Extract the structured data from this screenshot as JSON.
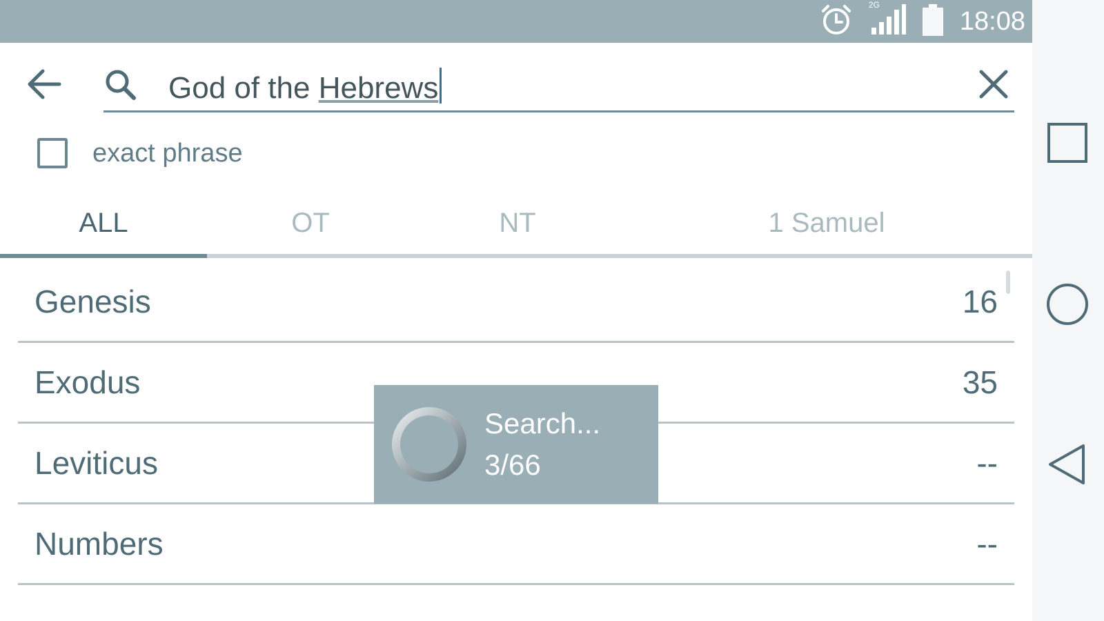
{
  "status_bar": {
    "time": "18:08",
    "network": "2G",
    "icons": [
      "alarm-icon",
      "signal-icon",
      "battery-icon"
    ]
  },
  "search": {
    "query_plain": "God of the ",
    "query_underlined": "Hebrews"
  },
  "exact_phrase": {
    "label": "exact phrase",
    "checked": false
  },
  "tabs": [
    {
      "label": "ALL",
      "active": true
    },
    {
      "label": "OT",
      "active": false
    },
    {
      "label": "NT",
      "active": false
    },
    {
      "label": "1 Samuel",
      "active": false
    }
  ],
  "results": [
    {
      "book": "Genesis",
      "count": "16"
    },
    {
      "book": "Exodus",
      "count": "35"
    },
    {
      "book": "Leviticus",
      "count": "--"
    },
    {
      "book": "Numbers",
      "count": "--"
    }
  ],
  "progress": {
    "title": "Search...",
    "count": "3/66"
  },
  "colors": {
    "accent": "#9aaeb5",
    "text": "#4f6b75",
    "tab_inactive": "#a9babf",
    "divider": "#b7c3c7"
  },
  "nav_icons": [
    "recent-apps-icon",
    "home-icon",
    "back-nav-icon"
  ]
}
